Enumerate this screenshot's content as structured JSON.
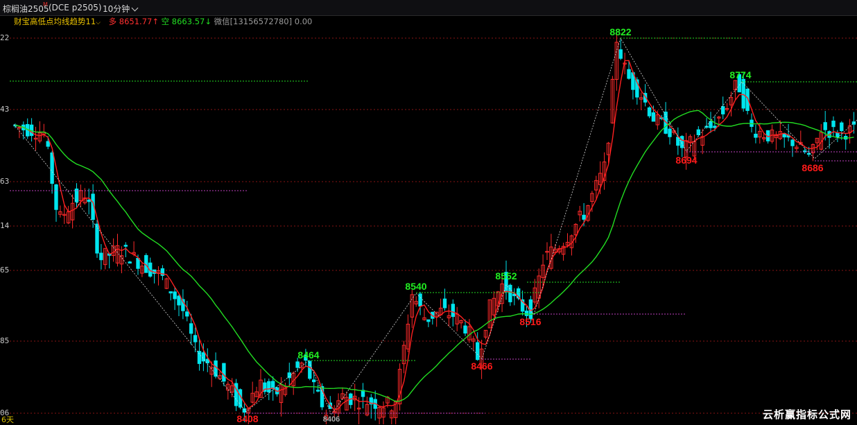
{
  "header": {
    "symbol_name": "棕榈油2505",
    "symbol_sup": "M",
    "exchange_code": "(DCE p2505)",
    "timeframe": "10分钟"
  },
  "legend": {
    "indicator": "财宝高低点均线趋势11",
    "long_label": "多",
    "long_value": "8651.77↑",
    "short_label": "空",
    "short_value": "8663.57↓",
    "contact": "微信[13156572780] 0.00"
  },
  "axis_labels": [
    "22",
    "43",
    "63",
    "14",
    "65",
    "85",
    "06"
  ],
  "bottom_left": "6天",
  "watermark": "云析赢指标公式网",
  "colors": {
    "up_candle": "#ff2a2a",
    "down_candle": "#00e5ee",
    "fast_ma": "#ff2020",
    "slow_ma": "#22dd22",
    "high_label": "#22ee22",
    "low_label": "#ff1a1a",
    "grid": "#8a1515"
  },
  "chart_data": {
    "type": "candlestick",
    "pivot_highs": [
      "8540",
      "8552",
      "8464",
      "8822",
      "8774"
    ],
    "pivot_lows": [
      "8408",
      "8406",
      "8466",
      "8516",
      "8694",
      "8686"
    ]
  }
}
